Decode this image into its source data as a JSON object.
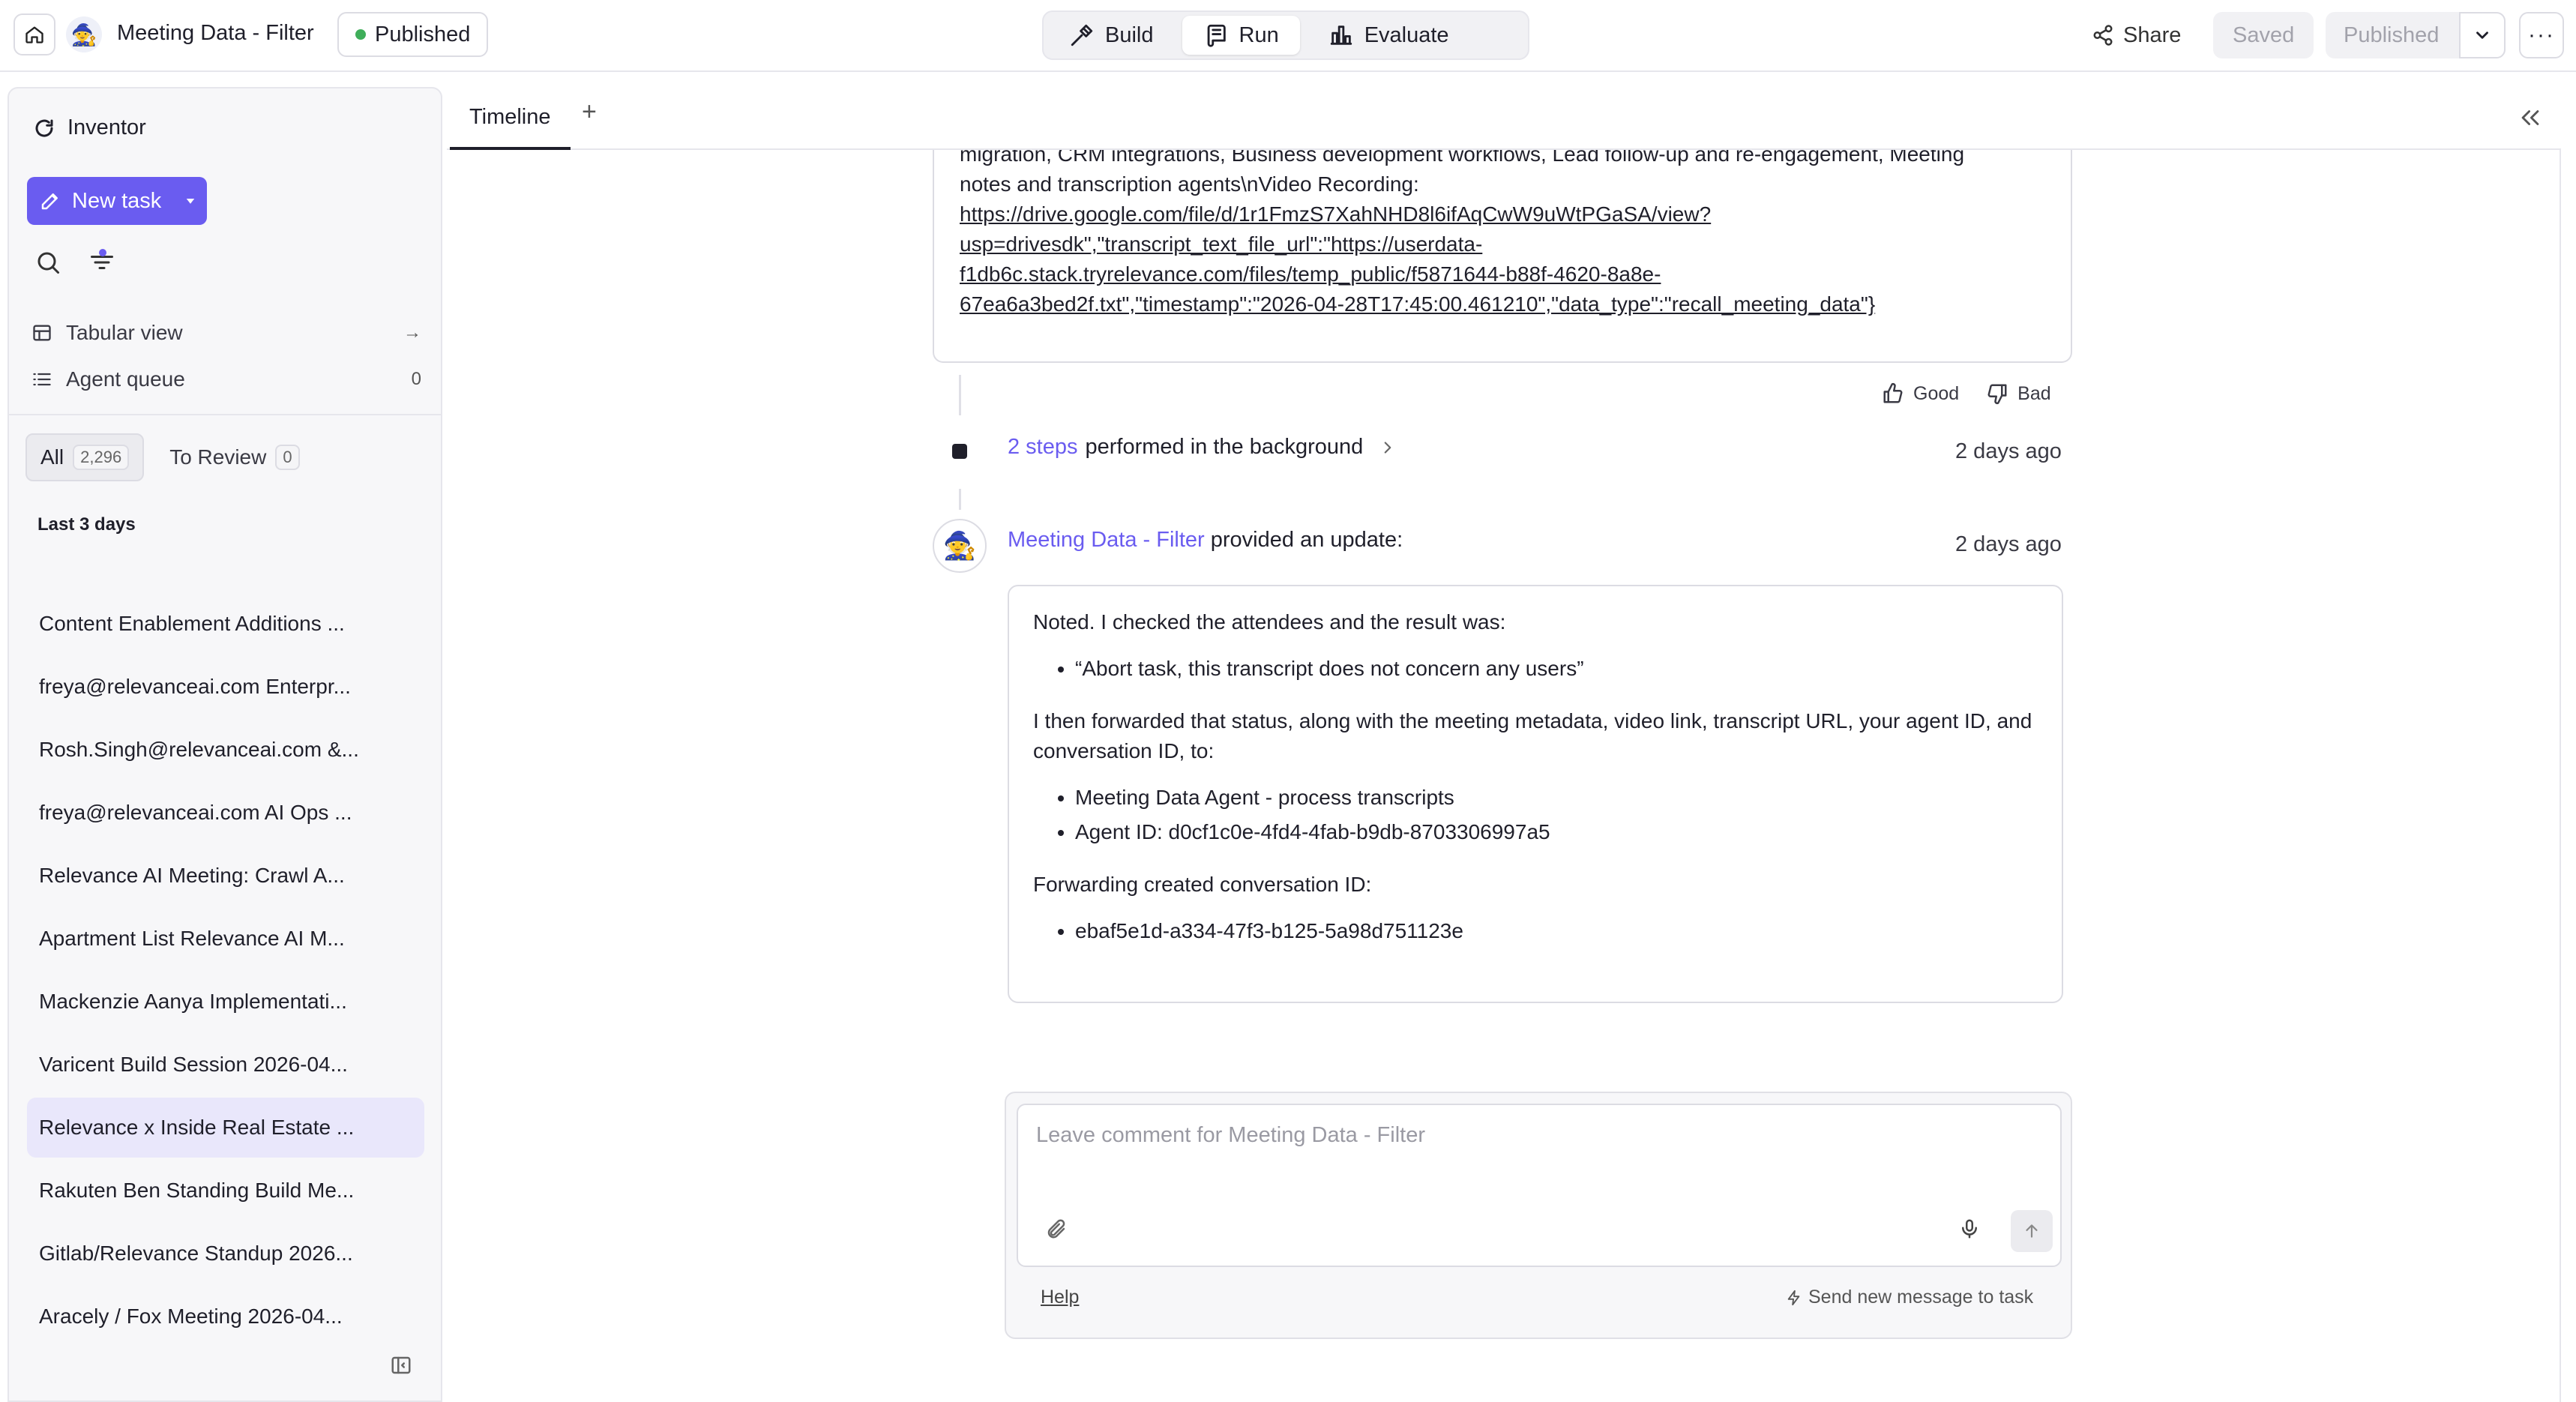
{
  "header": {
    "title": "Meeting Data - Filter",
    "status_badge": "Published",
    "modes": [
      "Build",
      "Run",
      "Evaluate"
    ],
    "active_mode": "Run",
    "share_label": "Share",
    "saved_label": "Saved",
    "published_label": "Published",
    "more_label": "···"
  },
  "sidebar": {
    "workspace": "Inventor",
    "new_task_label": "New task",
    "links": [
      {
        "label": "Tabular view",
        "icon": "table-icon",
        "right": "→"
      },
      {
        "label": "Agent queue",
        "icon": "list-icon",
        "right": "0"
      }
    ],
    "segments": [
      {
        "label": "All",
        "count": "2,296",
        "active": true
      },
      {
        "label": "To Review",
        "count": "0",
        "active": false
      }
    ],
    "group_label": "Last 3 days",
    "tasks": [
      "Content Enablement Additions ...",
      "freya@relevanceai.com Enterpr...",
      "Rosh.Singh@relevanceai.com &...",
      "freya@relevanceai.com AI Ops ...",
      "Relevance AI Meeting: Crawl A...",
      "Apartment List Relevance AI M...",
      "Mackenzie Aanya Implementati...",
      "Varicent Build Session 2026-04...",
      "Relevance x Inside Real Estate ...",
      "Rakuten Ben Standing Build Me...",
      "Gitlab/Relevance Standup 2026...",
      "Aracely / Fox Meeting 2026-04..."
    ],
    "selected_task_index": 8
  },
  "tabs": {
    "timeline_label": "Timeline",
    "add_label": "+"
  },
  "timeline": {
    "previous_message": {
      "line1": "migration, CRM integrations, Business development workflows, Lead follow-up and re-engagement, Meeting",
      "line2": "notes and transcription agents\\nVideo Recording:",
      "link1": "https://drive.google.com/file/d/1r1FmzS7XahNHD8l6ifAqCwW9uWtPGaSA/view?",
      "link2": "usp=drivesdk\",\"transcript_text_file_url\":\"https://userdata-",
      "link3": "f1db6c.stack.tryrelevance.com/files/temp_public/f5871644-b88f-4620-8a8e-",
      "link4": "67ea6a3bed2f.txt\",\"timestamp\":\"2026-04-28T17:45:00.461210\",\"data_type\":\"recall_meeting_data\"}"
    },
    "feedback": {
      "good": "Good",
      "bad": "Bad"
    },
    "background_steps": {
      "link": "2 steps",
      "text": "performed in the background",
      "time": "2 days ago"
    },
    "update": {
      "agent_name": "Meeting Data - Filter",
      "text": "provided an update:",
      "time": "2 days ago",
      "intro": "Noted. I checked the attendees and the result was:",
      "result_items": [
        "“Abort task, this transcript does not concern any users”"
      ],
      "forward_text": "I then forwarded that status, along with the meeting metadata, video link, transcript URL, your agent ID, and conversation ID, to:",
      "forward_items": [
        "Meeting Data Agent - process transcripts",
        "Agent ID: d0cf1c0e-4fd4-4fab-b9db-8703306997a5"
      ],
      "created_label": "Forwarding created conversation ID:",
      "created_items": [
        "ebaf5e1d-a334-47f3-b125-5a98d751123e"
      ]
    }
  },
  "composer": {
    "placeholder": "Leave comment for Meeting Data - Filter",
    "help_label": "Help",
    "send_new_label": "Send new message to task"
  },
  "colors": {
    "accent": "#6a5cf0",
    "published_dot": "#3fae5a",
    "selected_bg": "#e9e7fb"
  }
}
